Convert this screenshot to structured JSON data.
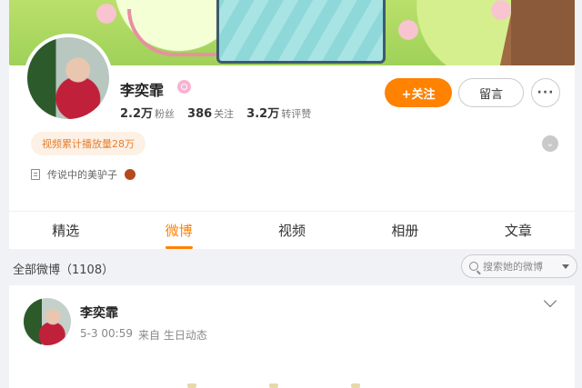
{
  "profile": {
    "name": "李奕霏",
    "stats": [
      {
        "num": "2.2万",
        "label": "粉丝"
      },
      {
        "num": "386",
        "label": "关注"
      },
      {
        "num": "3.2万",
        "label": "转评赞"
      }
    ],
    "follow_label": "+关注",
    "message_label": "留言",
    "more_label": "···",
    "play_badge": "视频累计播放量28万",
    "bio": "传说中的美驴子"
  },
  "tabs": [
    "精选",
    "微博",
    "视频",
    "相册",
    "文章"
  ],
  "active_tab": "微博",
  "filter": {
    "label": "全部微博（1108）",
    "search_placeholder": "搜索她的微博"
  },
  "post": {
    "author": "李奕霏",
    "time": "5-3 00:59",
    "source": "来自 生日动态"
  },
  "colors": {
    "accent": "#ff8200",
    "badge_bg": "#fdf0e4",
    "badge_text": "#e37f2f"
  }
}
